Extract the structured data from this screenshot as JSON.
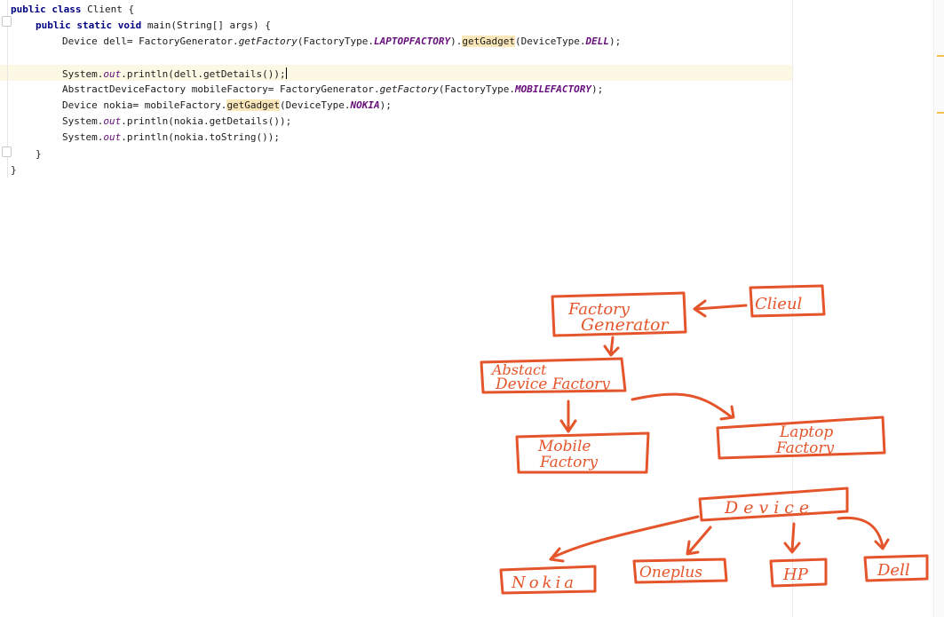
{
  "code": {
    "class_decl": {
      "keywords": "public class",
      "name": "Client",
      "brace": "{"
    },
    "method_decl": {
      "keywords": "public static void",
      "signature": "main(String[] args)",
      "brace": "{"
    },
    "line_dell": {
      "prefix": "Device dell= FactoryGenerator.",
      "method": "getFactory",
      "arg_open": "(FactoryType.",
      "constant": "LAPTOPFACTORY",
      "mid": ").",
      "call": "getGadget",
      "tail_open": "(DeviceType.",
      "tail_const": "DELL",
      "tail_close": ");"
    },
    "line_print_dell": {
      "prefix": "System.",
      "field": "out",
      "rest": ".println(dell.getDetails());"
    },
    "line_mobile": {
      "prefix": "AbstractDeviceFactory mobileFactory= FactoryGenerator.",
      "method": "getFactory",
      "arg_open": "(FactoryType.",
      "constant": "MOBILEFACTORY",
      "close": ");"
    },
    "line_nokia": {
      "prefix": "Device nokia= mobileFactory.",
      "call": "getGadget",
      "arg_open": "(DeviceType.",
      "constant": "NOKIA",
      "close": ");"
    },
    "line_print_details": {
      "prefix": "System.",
      "field": "out",
      "rest": ".println(nokia.getDetails());"
    },
    "line_print_tostring": {
      "prefix": "System.",
      "field": "out",
      "rest": ".println(nokia.toString());"
    },
    "close_method": "}",
    "close_class": "}"
  },
  "diagram": {
    "factory_generator": [
      "Factory",
      "Generator"
    ],
    "client": "Clieul",
    "abstract_factory": [
      "Abstact",
      "Device Factory"
    ],
    "mobile_factory": [
      "Mobile",
      "Factory"
    ],
    "laptop_factory": [
      "Laptop",
      "Factory"
    ],
    "device": "Device",
    "nokia": "Nokia",
    "oneplus": "Oneplus",
    "hp": "HP",
    "dell": "Dell",
    "ink_color": "#e5552b"
  }
}
